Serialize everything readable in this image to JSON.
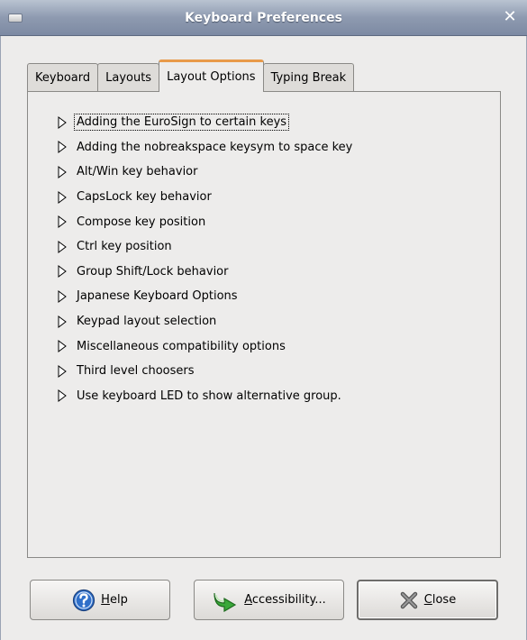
{
  "window": {
    "title": "Keyboard Preferences",
    "close_glyph": "✕"
  },
  "tabs": [
    {
      "label": "Keyboard",
      "active": false
    },
    {
      "label": "Layouts",
      "active": false
    },
    {
      "label": "Layout Options",
      "active": true
    },
    {
      "label": "Typing Break",
      "active": false
    }
  ],
  "options": [
    {
      "label": "Adding the EuroSign to certain keys"
    },
    {
      "label": "Adding the nobreakspace keysym to space key"
    },
    {
      "label": "Alt/Win key behavior"
    },
    {
      "label": "CapsLock key behavior"
    },
    {
      "label": "Compose key position"
    },
    {
      "label": "Ctrl key position"
    },
    {
      "label": "Group Shift/Lock behavior"
    },
    {
      "label": "Japanese Keyboard Options"
    },
    {
      "label": "Keypad layout selection"
    },
    {
      "label": "Miscellaneous compatibility options"
    },
    {
      "label": "Third level choosers"
    },
    {
      "label": "Use keyboard LED to show alternative group."
    }
  ],
  "buttons": {
    "help": {
      "mnemonic": "H",
      "rest": "elp",
      "icon": "help-icon"
    },
    "accessibility": {
      "mnemonic": "A",
      "rest": "ccessibility...",
      "icon": "accessibility-arrow-icon"
    },
    "close": {
      "mnemonic": "C",
      "rest": "lose",
      "icon": "close-x-icon"
    }
  },
  "colors": {
    "tab_active_accent": "#e89a4a",
    "titlebar": "#8e9ab0",
    "background": "#edeceb"
  }
}
